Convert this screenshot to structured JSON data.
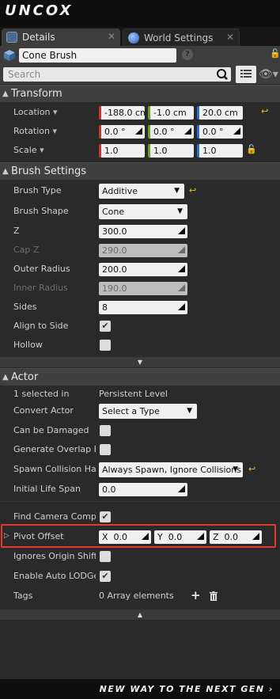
{
  "app": {
    "logo": "UNCOX",
    "tagline": "NEW WAY TO THE NEXT GEN ›"
  },
  "tabs": [
    {
      "label": "Details",
      "active": true
    },
    {
      "label": "World Settings",
      "active": false
    }
  ],
  "header": {
    "object_name": "Cone Brush",
    "search_placeholder": "Search"
  },
  "transform": {
    "title": "Transform",
    "location": {
      "label": "Location",
      "x": "-188.0 cm",
      "y": "-1.0 cm",
      "z": "20.0 cm"
    },
    "rotation": {
      "label": "Rotation",
      "x": "0.0 °",
      "y": "0.0 °",
      "z": "0.0 °"
    },
    "scale": {
      "label": "Scale",
      "x": "1.0",
      "y": "1.0",
      "z": "1.0"
    }
  },
  "brush": {
    "title": "Brush Settings",
    "brush_type": {
      "label": "Brush Type",
      "value": "Additive"
    },
    "brush_shape": {
      "label": "Brush Shape",
      "value": "Cone"
    },
    "z": {
      "label": "Z",
      "value": "300.0"
    },
    "cap_z": {
      "label": "Cap Z",
      "value": "290.0"
    },
    "outer_radius": {
      "label": "Outer Radius",
      "value": "200.0"
    },
    "inner_radius": {
      "label": "Inner Radius",
      "value": "190.0"
    },
    "sides": {
      "label": "Sides",
      "value": "8"
    },
    "align_to_side": {
      "label": "Align to Side",
      "checked": true
    },
    "hollow": {
      "label": "Hollow",
      "checked": false
    }
  },
  "actor": {
    "title": "Actor",
    "selected": {
      "label": "1 selected in",
      "value": "Persistent Level"
    },
    "convert_actor": {
      "label": "Convert Actor",
      "value": "Select a Type"
    },
    "can_be_damaged": {
      "label": "Can be Damaged",
      "checked": false
    },
    "generate_overlap": {
      "label": "Generate Overlap Ev",
      "checked": false
    },
    "spawn_collision": {
      "label": "Spawn Collision Han",
      "value": "Always Spawn, Ignore Collisions"
    },
    "initial_life_span": {
      "label": "Initial Life Span",
      "value": "0.0"
    },
    "find_camera": {
      "label": "Find Camera Compo",
      "checked": true
    },
    "pivot_offset": {
      "label": "Pivot Offset",
      "x_label": "X",
      "x": "0.0",
      "y_label": "Y",
      "y": "0.0",
      "z_label": "Z",
      "z": "0.0"
    },
    "ignores_origin": {
      "label": "Ignores Origin Shiftir",
      "checked": false
    },
    "auto_lod": {
      "label": "Enable Auto LODGen",
      "checked": true
    },
    "tags": {
      "label": "Tags",
      "value": "0 Array elements"
    }
  },
  "colors": {
    "accent_highlight": "#e03a2e",
    "x_axis": "#c0392b",
    "y_axis": "#6aa321",
    "z_axis": "#2e6fd6",
    "reset_arrow": "#e0c32a"
  }
}
